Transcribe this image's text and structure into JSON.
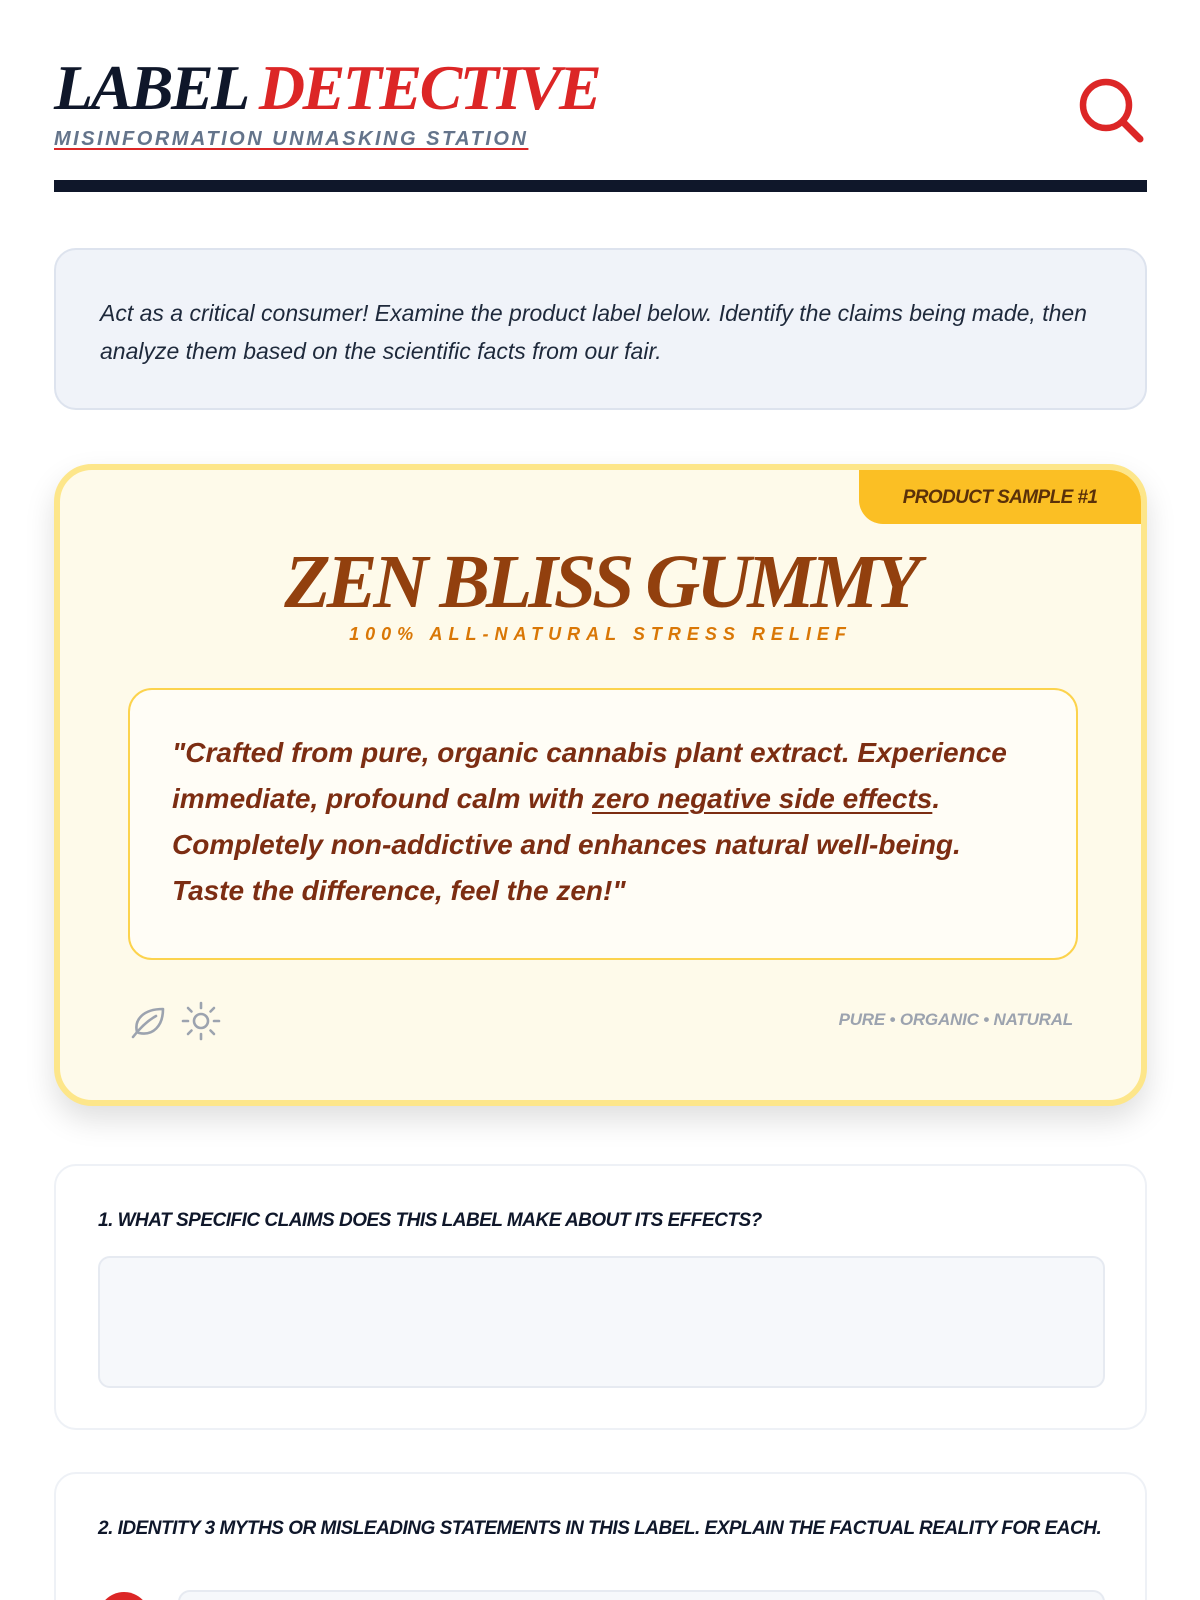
{
  "header": {
    "title_part1": "LABEL",
    "title_part2": "DETECTIVE",
    "subtitle": "MISINFORMATION UNMASKING STATION",
    "search_icon": "magnifier-icon"
  },
  "intro": {
    "text": "Act as a critical consumer! Examine the product label below. Identify the claims being made, then analyze them based on the scientific facts from our fair."
  },
  "product": {
    "tag": "PRODUCT SAMPLE #1",
    "name": "ZEN BLISS GUMMY",
    "tagline": "100% ALL-NATURAL STRESS RELIEF",
    "claim_part1": "\"Crafted from pure, organic cannabis plant extract. Experience immediate, profound calm with ",
    "claim_highlight": "zero negative side effects",
    "claim_part2": ". Completely non-addictive and enhances natural well-being. Taste the difference, feel the zen!\"",
    "icons": [
      "leaf-icon",
      "sun-icon"
    ],
    "badges": "PURE • ORGANIC • NATURAL"
  },
  "questions": [
    {
      "label": "1. WHAT SPECIFIC CLAIMS DOES THIS LABEL MAKE ABOUT ITS EFFECTS?",
      "answer": ""
    },
    {
      "label": "2. IDENTITY 3 MYTHS OR MISLEADING STATEMENTS IN THIS LABEL. EXPLAIN THE FACTUAL REALITY FOR EACH.",
      "answer": ""
    }
  ],
  "colors": {
    "navy": "#0f172a",
    "accent_red": "#dc2626",
    "label_brown": "#92400e",
    "tag_yellow": "#fbbf24",
    "label_bg": "#fefaea"
  }
}
